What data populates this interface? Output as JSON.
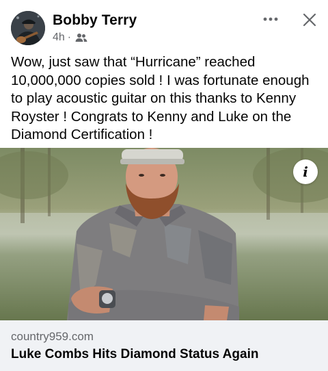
{
  "post": {
    "author": "Bobby Terry",
    "time": "4h",
    "separator": "·",
    "audience_icon": "friends-icon",
    "text": "Wow, just saw that “Hurricane” reached 10,000,000 copies sold ! I was fortunate enough to play acoustic guitar on this thanks to Kenny Royster ! Congrats to Kenny and Luke on the Diamond Certification !"
  },
  "header": {
    "more_icon": "more-horizontal-icon",
    "close_icon": "close-icon"
  },
  "link_preview": {
    "domain": "country959.com",
    "headline": "Luke Combs Hits Diamond Status Again",
    "info_label": "i"
  },
  "colors": {
    "text_primary": "#050505",
    "text_secondary": "#65676b",
    "link_bg": "#f0f2f5"
  }
}
